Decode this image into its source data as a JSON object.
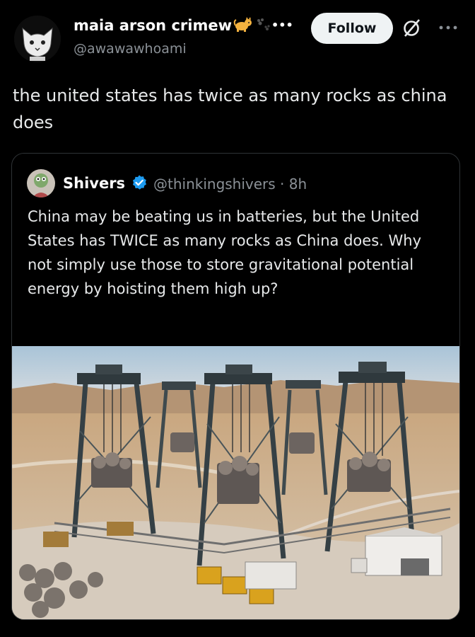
{
  "post": {
    "author_name": "maia arson crimew",
    "name_emoji": "cat-emoji",
    "handle": "@awawawhoami",
    "follow_label": "Follow",
    "text": "the united states has twice as many rocks as china does"
  },
  "quoted": {
    "name": "Shivers",
    "verified_icon": "verified-badge-icon",
    "handle_time": "@thinkingshivers · 8h",
    "text": "China may be beating us in batteries, but the United States has TWICE as many rocks as China does. Why not simply use those to store gravitational potential energy by hoisting them high up?",
    "image": "ai-generated-gravity-storage-gantry-cranes-in-desert"
  },
  "colors": {
    "background": "#000000",
    "text": "#e7e9ea",
    "secondary": "#8b9197",
    "verified": "#1d9bf0",
    "follow_bg": "#eff3f4"
  }
}
